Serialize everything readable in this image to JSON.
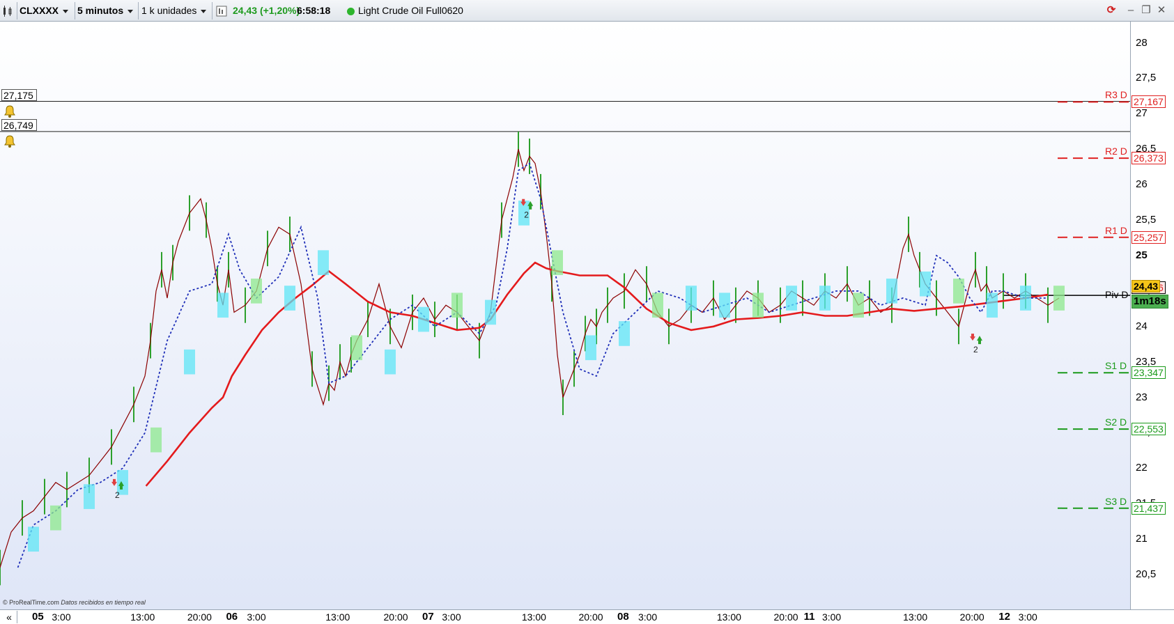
{
  "toolbar": {
    "symbol": "CLXXXX",
    "timeframe": "5 minutos",
    "units": "1 k unidades",
    "last_price": "24,43",
    "change": "(+1,20%)",
    "time": "6:58:18",
    "instrument": "Light Crude Oil Full0620"
  },
  "colors": {
    "price_line": "#8b0000",
    "candles": "#2ca02c",
    "moving_average": "#e41a1c",
    "dotted_average": "#1f2fb8",
    "cloud_cyan": "#5fe6f5",
    "cloud_green": "#8ee88e",
    "resistance": "#e02020",
    "support": "#1a9a1a",
    "pivot": "#000000",
    "last_price_bg": "#f5c518",
    "countdown_bg": "#4caf50"
  },
  "alerts": [
    {
      "value": "27,175",
      "icon": "bell-icon"
    },
    {
      "value": "26,749",
      "icon": "bell-icon"
    }
  ],
  "pivots": [
    {
      "label": "R3 D",
      "value": "27,167",
      "y": 27.167,
      "kind": "resistance"
    },
    {
      "label": "R2 D",
      "value": "26,373",
      "y": 26.373,
      "kind": "resistance"
    },
    {
      "label": "R1 D",
      "value": "25,257",
      "y": 25.257,
      "kind": "resistance"
    },
    {
      "label": "Piv D",
      "value": "24,546",
      "y": 24.546,
      "kind": "pivot"
    },
    {
      "label": "S1 D",
      "value": "23,347",
      "y": 23.347,
      "kind": "support"
    },
    {
      "label": "S2 D",
      "value": "22,553",
      "y": 22.553,
      "kind": "support"
    },
    {
      "label": "S3 D",
      "value": "21,437",
      "y": 21.437,
      "kind": "support"
    }
  ],
  "current_price_box": "24,43",
  "countdown": "1m18s",
  "signal_markers": [
    {
      "x": 0.105,
      "label": "2"
    },
    {
      "x": 0.472,
      "label": "2"
    },
    {
      "x": 0.875,
      "label": "2"
    }
  ],
  "footer": {
    "brand": "© ProRealTime.com",
    "status": "Datos recibidos en tiempo real"
  },
  "chart_data": {
    "type": "line",
    "ylim": [
      20,
      28.3
    ],
    "y_ticks": [
      "28",
      "27,5",
      "27",
      "26,5",
      "26",
      "25,5",
      "25",
      "24,5",
      "24",
      "23,5",
      "23",
      "22,5",
      "22",
      "21,5",
      "21",
      "20,5"
    ],
    "y_tick_values": [
      28,
      27.5,
      27,
      26.5,
      26,
      25.5,
      25,
      24.5,
      24,
      23.5,
      23,
      22.5,
      22,
      21.5,
      21,
      20.5
    ],
    "x_ticks": [
      {
        "label": "05",
        "x": 0.034,
        "bold": true
      },
      {
        "label": "3:00",
        "x": 0.055,
        "bold": false
      },
      {
        "label": "13:00",
        "x": 0.128,
        "bold": false
      },
      {
        "label": "20:00",
        "x": 0.179,
        "bold": false
      },
      {
        "label": "06",
        "x": 0.208,
        "bold": true
      },
      {
        "label": "3:00",
        "x": 0.23,
        "bold": false
      },
      {
        "label": "13:00",
        "x": 0.303,
        "bold": false
      },
      {
        "label": "20:00",
        "x": 0.355,
        "bold": false
      },
      {
        "label": "07",
        "x": 0.384,
        "bold": true
      },
      {
        "label": "3:00",
        "x": 0.405,
        "bold": false
      },
      {
        "label": "13:00",
        "x": 0.479,
        "bold": false
      },
      {
        "label": "20:00",
        "x": 0.53,
        "bold": false
      },
      {
        "label": "08",
        "x": 0.559,
        "bold": true
      },
      {
        "label": "3:00",
        "x": 0.581,
        "bold": false
      },
      {
        "label": "13:00",
        "x": 0.654,
        "bold": false
      },
      {
        "label": "20:00",
        "x": 0.705,
        "bold": false
      },
      {
        "label": "11",
        "x": 0.726,
        "bold": true
      },
      {
        "label": "3:00",
        "x": 0.746,
        "bold": false
      },
      {
        "label": "13:00",
        "x": 0.821,
        "bold": false
      },
      {
        "label": "20:00",
        "x": 0.872,
        "bold": false
      },
      {
        "label": "12",
        "x": 0.901,
        "bold": true
      },
      {
        "label": "3:00",
        "x": 0.922,
        "bold": false
      }
    ],
    "series": [
      {
        "kind": "price",
        "x": [
          0.0,
          0.01,
          0.02,
          0.03,
          0.04,
          0.05,
          0.06,
          0.07,
          0.08,
          0.09,
          0.1,
          0.11,
          0.12,
          0.13,
          0.135,
          0.14,
          0.145,
          0.15,
          0.155,
          0.16,
          0.17,
          0.18,
          0.185,
          0.19,
          0.195,
          0.2,
          0.205,
          0.21,
          0.22,
          0.23,
          0.24,
          0.25,
          0.26,
          0.27,
          0.28,
          0.29,
          0.295,
          0.3,
          0.305,
          0.31,
          0.315,
          0.32,
          0.33,
          0.34,
          0.35,
          0.36,
          0.37,
          0.38,
          0.39,
          0.4,
          0.41,
          0.42,
          0.43,
          0.44,
          0.45,
          0.46,
          0.465,
          0.47,
          0.475,
          0.48,
          0.485,
          0.49,
          0.495,
          0.5,
          0.505,
          0.51,
          0.515,
          0.52,
          0.525,
          0.53,
          0.535,
          0.54,
          0.545,
          0.55,
          0.56,
          0.57,
          0.58,
          0.59,
          0.6,
          0.61,
          0.62,
          0.63,
          0.64,
          0.65,
          0.66,
          0.67,
          0.68,
          0.69,
          0.7,
          0.71,
          0.72,
          0.73,
          0.74,
          0.75,
          0.76,
          0.77,
          0.78,
          0.79,
          0.8,
          0.81,
          0.815,
          0.82,
          0.825,
          0.83,
          0.84,
          0.85,
          0.86,
          0.87,
          0.875,
          0.88,
          0.885,
          0.89,
          0.9,
          0.91,
          0.92,
          0.93,
          0.94,
          0.95
        ],
        "y": [
          20.6,
          21.1,
          21.3,
          21.4,
          21.6,
          21.8,
          21.7,
          21.8,
          21.9,
          22.1,
          22.3,
          22.6,
          22.9,
          23.3,
          23.8,
          24.5,
          24.8,
          24.4,
          24.9,
          25.2,
          25.6,
          25.8,
          25.5,
          25.1,
          24.6,
          24.3,
          24.8,
          24.2,
          24.3,
          24.5,
          25.1,
          25.4,
          25.3,
          24.6,
          23.4,
          22.9,
          23.2,
          23.1,
          23.5,
          23.3,
          23.6,
          23.8,
          24.1,
          24.6,
          24.0,
          23.7,
          24.2,
          24.4,
          24.1,
          24.3,
          24.2,
          24.0,
          23.8,
          24.2,
          25.5,
          26.1,
          26.5,
          26.2,
          26.4,
          26.3,
          25.9,
          25.3,
          24.6,
          23.6,
          23.0,
          23.2,
          23.4,
          23.6,
          23.9,
          24.1,
          24.0,
          24.2,
          24.3,
          24.4,
          24.5,
          24.8,
          24.6,
          24.2,
          24.0,
          24.1,
          24.3,
          24.2,
          24.4,
          24.1,
          24.3,
          24.5,
          24.4,
          24.2,
          24.3,
          24.5,
          24.4,
          24.3,
          24.5,
          24.4,
          24.6,
          24.3,
          24.4,
          24.2,
          24.3,
          25.1,
          25.3,
          25.0,
          24.8,
          24.6,
          24.4,
          24.2,
          24.0,
          24.6,
          24.8,
          24.5,
          24.6,
          24.4,
          24.5,
          24.4,
          24.5,
          24.4,
          24.3,
          24.4
        ]
      },
      {
        "kind": "moving_average",
        "x": [
          0.131,
          0.15,
          0.17,
          0.19,
          0.2,
          0.208,
          0.22,
          0.235,
          0.25,
          0.265,
          0.28,
          0.295,
          0.31,
          0.33,
          0.35,
          0.37,
          0.39,
          0.41,
          0.43,
          0.44,
          0.455,
          0.47,
          0.48,
          0.49,
          0.5,
          0.51,
          0.52,
          0.53,
          0.545,
          0.56,
          0.58,
          0.6,
          0.62,
          0.64,
          0.66,
          0.68,
          0.7,
          0.72,
          0.74,
          0.76,
          0.78,
          0.8,
          0.82,
          0.84,
          0.86,
          0.88,
          0.9,
          0.92,
          0.94
        ],
        "y": [
          21.75,
          22.1,
          22.5,
          22.85,
          23.0,
          23.3,
          23.6,
          23.95,
          24.2,
          24.4,
          24.58,
          24.78,
          24.6,
          24.35,
          24.2,
          24.15,
          24.05,
          23.95,
          23.98,
          24.1,
          24.45,
          24.75,
          24.9,
          24.82,
          24.78,
          24.75,
          24.72,
          24.72,
          24.72,
          24.55,
          24.25,
          24.05,
          23.95,
          24.0,
          24.1,
          24.12,
          24.15,
          24.2,
          24.15,
          24.15,
          24.2,
          24.25,
          24.22,
          24.25,
          24.28,
          24.32,
          24.36,
          24.4,
          24.45
        ]
      },
      {
        "kind": "dotted_average",
        "x": [
          0.016,
          0.03,
          0.05,
          0.07,
          0.09,
          0.11,
          0.13,
          0.15,
          0.17,
          0.19,
          0.205,
          0.215,
          0.23,
          0.25,
          0.27,
          0.285,
          0.295,
          0.31,
          0.33,
          0.35,
          0.37,
          0.39,
          0.41,
          0.43,
          0.445,
          0.455,
          0.465,
          0.475,
          0.485,
          0.495,
          0.505,
          0.52,
          0.535,
          0.55,
          0.57,
          0.59,
          0.61,
          0.63,
          0.65,
          0.67,
          0.69,
          0.71,
          0.73,
          0.75,
          0.77,
          0.79,
          0.81,
          0.83,
          0.84,
          0.85,
          0.86,
          0.87,
          0.88,
          0.89,
          0.9,
          0.92,
          0.94
        ],
        "y": [
          20.6,
          21.2,
          21.4,
          21.7,
          21.8,
          22.0,
          22.5,
          23.8,
          24.5,
          24.6,
          25.3,
          24.8,
          24.4,
          24.7,
          25.4,
          24.4,
          23.2,
          23.3,
          23.7,
          24.1,
          24.3,
          24.0,
          24.2,
          23.9,
          24.3,
          25.1,
          26.2,
          26.3,
          25.8,
          25.0,
          24.2,
          23.4,
          23.3,
          23.9,
          24.2,
          24.5,
          24.4,
          24.2,
          24.3,
          24.4,
          24.2,
          24.3,
          24.4,
          24.5,
          24.5,
          24.3,
          24.4,
          24.3,
          25.0,
          24.9,
          24.7,
          24.4,
          24.2,
          24.5,
          24.5,
          24.4,
          24.4
        ]
      },
      {
        "kind": "cloud",
        "x": [
          0.03,
          0.05,
          0.08,
          0.11,
          0.14,
          0.17,
          0.2,
          0.23,
          0.26,
          0.29,
          0.32,
          0.35,
          0.38,
          0.41,
          0.44,
          0.47,
          0.5,
          0.53,
          0.56,
          0.59,
          0.62,
          0.65,
          0.68,
          0.71,
          0.74,
          0.77,
          0.8,
          0.83,
          0.86,
          0.89,
          0.92,
          0.95
        ],
        "y": [
          21.0,
          21.3,
          21.6,
          21.8,
          22.4,
          23.5,
          24.3,
          24.5,
          24.4,
          24.9,
          23.7,
          23.5,
          24.1,
          24.3,
          24.2,
          25.6,
          24.9,
          23.7,
          23.9,
          24.3,
          24.4,
          24.3,
          24.3,
          24.4,
          24.4,
          24.3,
          24.5,
          24.6,
          24.5,
          24.3,
          24.4,
          24.4
        ]
      }
    ]
  }
}
